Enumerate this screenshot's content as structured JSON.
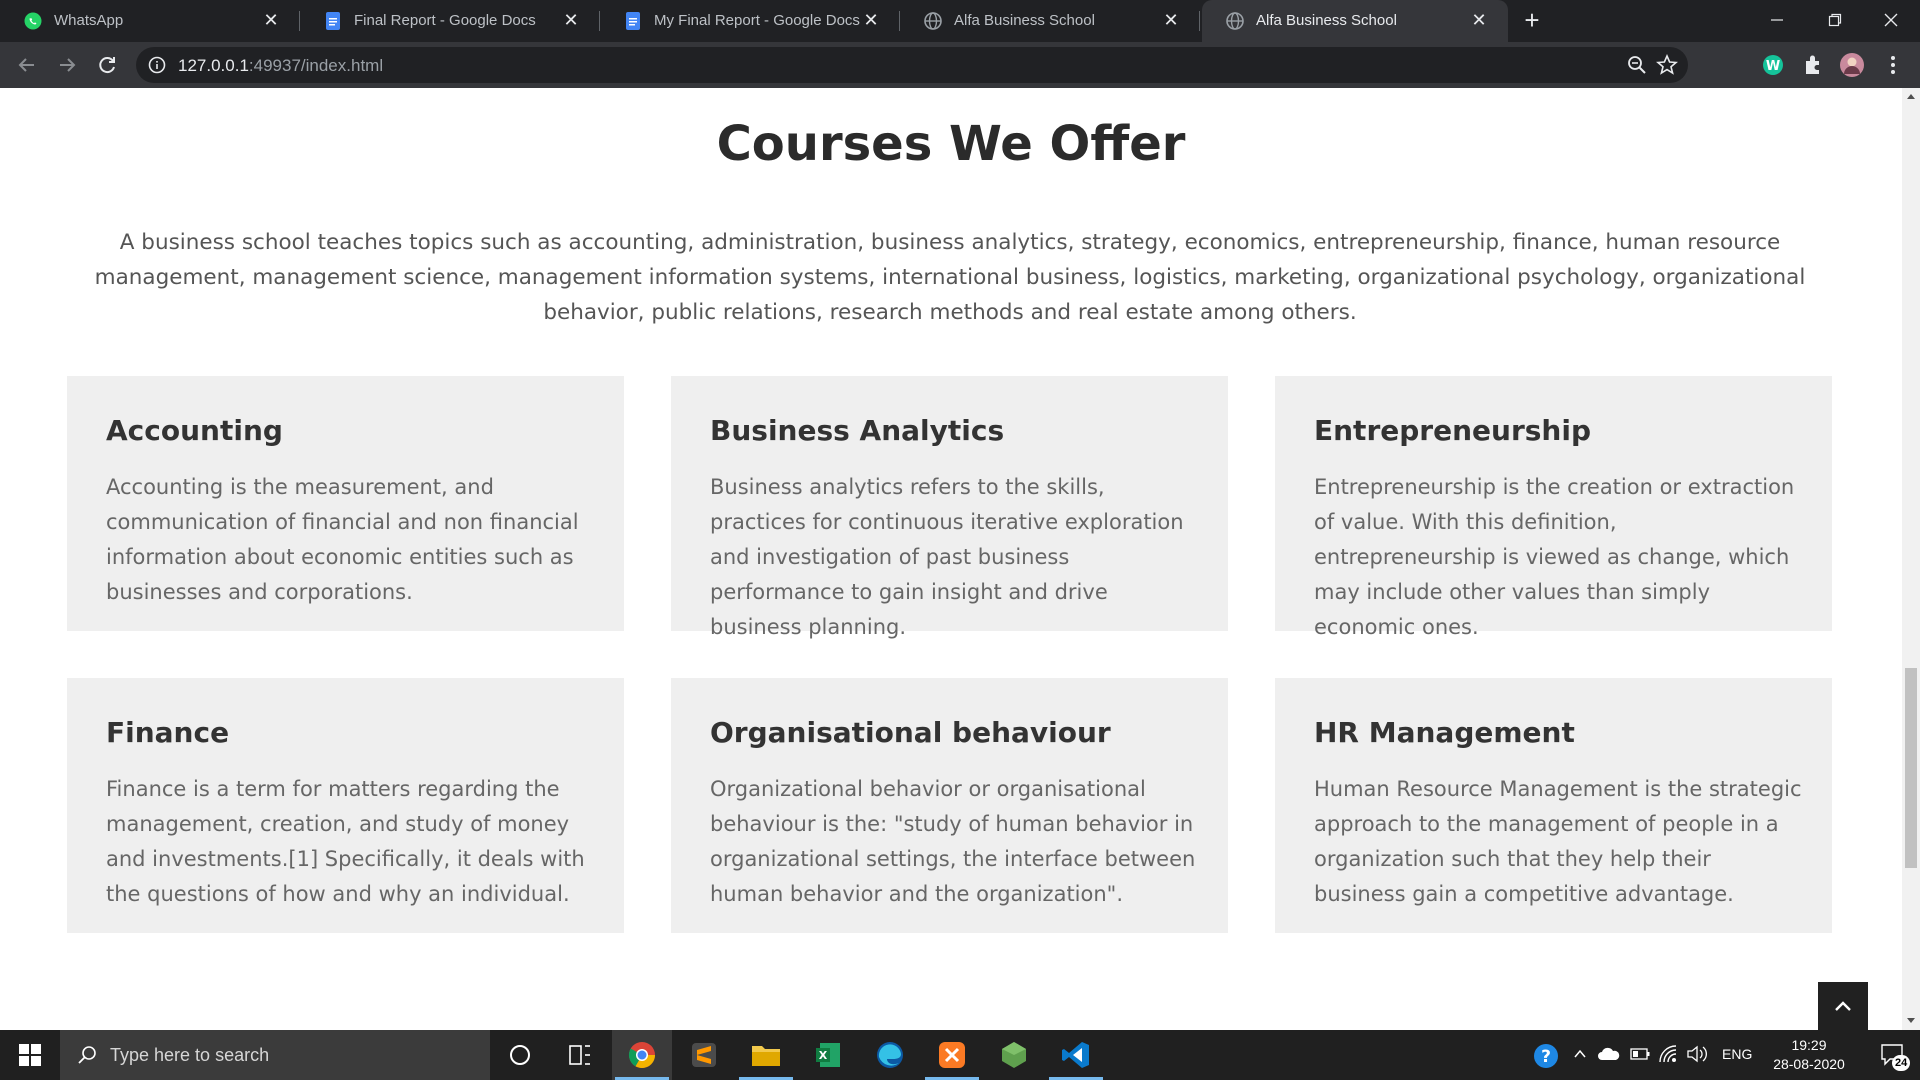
{
  "browser": {
    "tabs": [
      {
        "title": "WhatsApp",
        "icon": "whatsapp-icon"
      },
      {
        "title": "Final Report - Google Docs",
        "icon": "google-docs-icon"
      },
      {
        "title": "My Final Report - Google Docs",
        "icon": "google-docs-icon"
      },
      {
        "title": "Alfa Business School",
        "icon": "globe-icon"
      },
      {
        "title": "Alfa Business School",
        "icon": "globe-icon",
        "active": true
      }
    ],
    "address": {
      "host": "127.0.0.1",
      "rest": ":49937/index.html"
    }
  },
  "page": {
    "title": "Courses We Offer",
    "intro": "A business school teaches topics such as accounting, administration, business analytics, strategy, economics, entrepreneurship, finance, human resource management, management science, management information systems, international business, logistics, marketing, organizational psychology, organizational behavior, public relations, research methods and real estate among others.",
    "courses": [
      {
        "title": "Accounting",
        "text": "Accounting is the measurement, and communication of financial and non financial information about economic entities such as businesses and corporations."
      },
      {
        "title": "Business Analytics",
        "text": "Business analytics refers to the skills, practices for continuous iterative exploration and investigation of past business performance to gain insight and drive business planning."
      },
      {
        "title": "Entrepreneurship",
        "text": "Entrepreneurship is the creation or extraction of value. With this definition, entrepreneurship is viewed as change, which may include other values than simply economic ones."
      },
      {
        "title": "Finance",
        "text": "Finance is a term for matters regarding the management, creation, and study of money and investments.[1] Specifically, it deals with the questions of how and why an individual."
      },
      {
        "title": "Organisational behaviour",
        "text": "Organizational behavior or organisational behaviour is the: \"study of human behavior in organizational settings, the interface between human behavior and the organization\"."
      },
      {
        "title": "HR Management",
        "text": "Human Resource Management is the strategic approach to the management of people in a organization such that they help their business gain a competitive advantage."
      }
    ]
  },
  "taskbar": {
    "search_placeholder": "Type here to search",
    "tray": {
      "language": "ENG",
      "time": "19:29",
      "date": "28-08-2020",
      "notifications": "24"
    }
  },
  "colors": {
    "accent": "#76b9ed",
    "card_bg": "#efefef",
    "chrome_dark": "#202124"
  }
}
